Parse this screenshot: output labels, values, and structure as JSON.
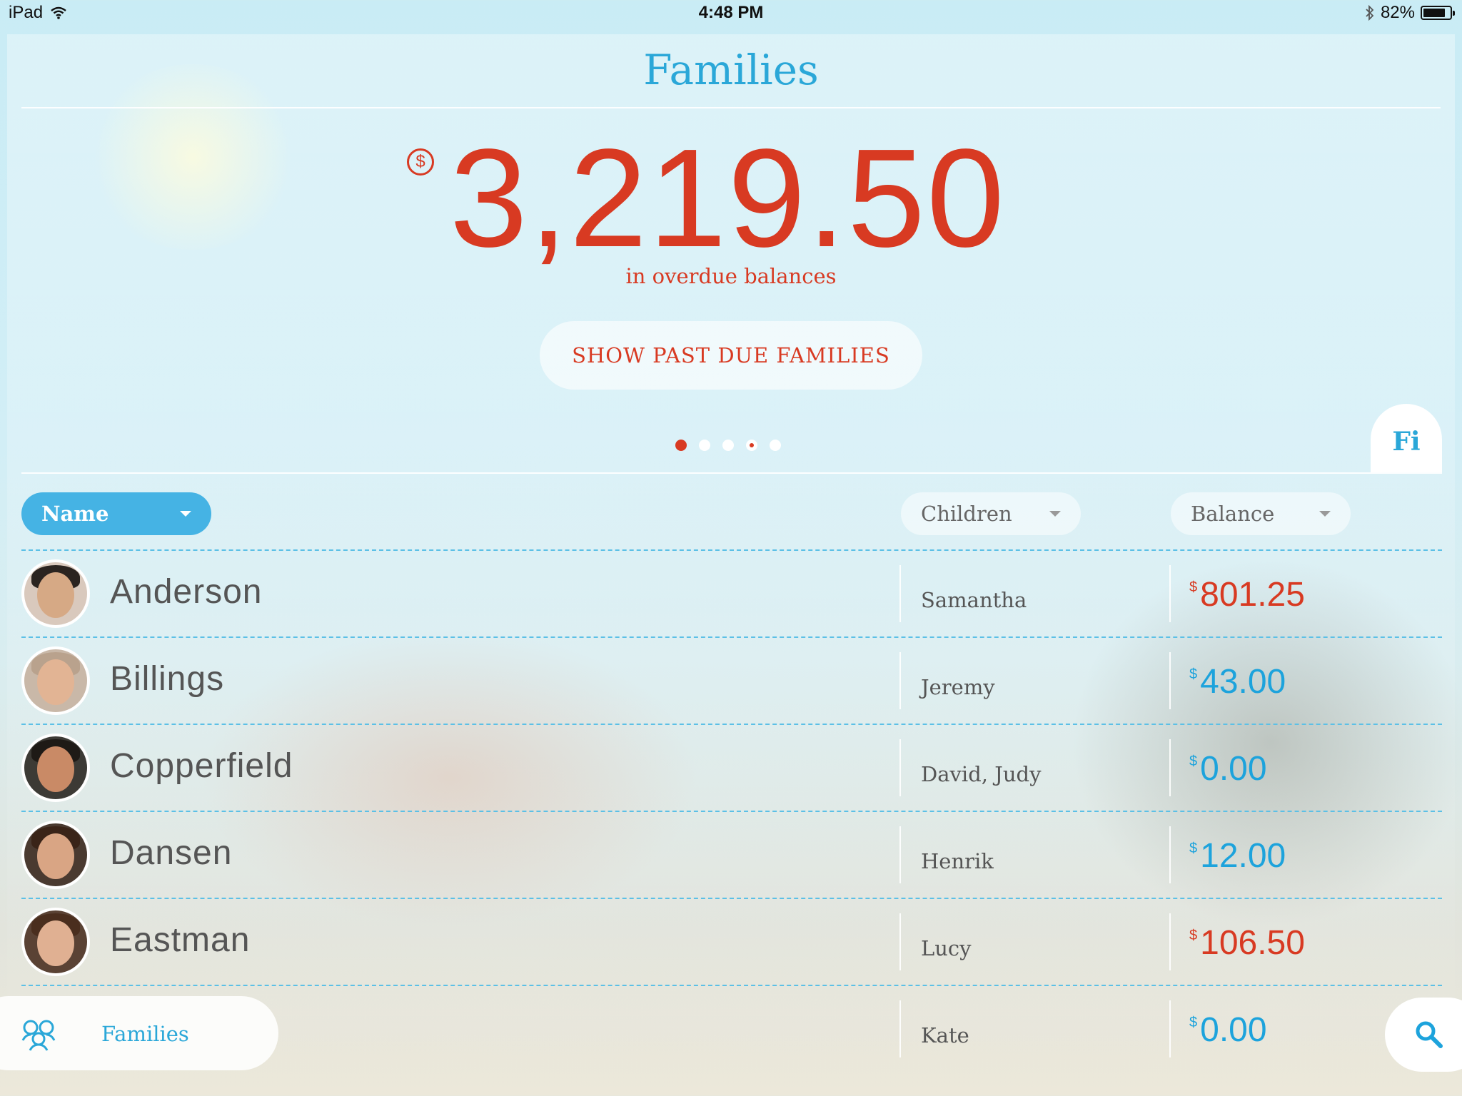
{
  "status_bar": {
    "device": "iPad",
    "time": "4:48 PM",
    "battery_percent": "82%",
    "battery_level": 0.82,
    "icons": [
      "wifi-icon",
      "bluetooth-icon",
      "battery-icon"
    ]
  },
  "header": {
    "title": "Families"
  },
  "summary": {
    "currency_symbol": "$",
    "total": "3,219.50",
    "caption": "in overdue balances",
    "button_label": "SHOW PAST DUE FAMILIES",
    "pager": {
      "count": 5,
      "active_index": 0,
      "marked_index": 3
    },
    "side_tab_label": "Fi"
  },
  "columns": {
    "name": "Name",
    "children": "Children",
    "balance": "Balance"
  },
  "families": [
    {
      "name": "Anderson",
      "children": "Samantha",
      "currency": "$",
      "balance": "801.25",
      "overdue": true
    },
    {
      "name": "Billings",
      "children": "Jeremy",
      "currency": "$",
      "balance": "43.00",
      "overdue": false
    },
    {
      "name": "Copperfield",
      "children": "David, Judy",
      "currency": "$",
      "balance": "0.00",
      "overdue": false
    },
    {
      "name": "Dansen",
      "children": "Henrik",
      "currency": "$",
      "balance": "12.00",
      "overdue": false
    },
    {
      "name": "Eastman",
      "children": "Lucy",
      "currency": "$",
      "balance": "106.50",
      "overdue": true
    },
    {
      "name": "",
      "children": "Kate",
      "currency": "$",
      "balance": "0.00",
      "overdue": false
    }
  ],
  "bottom_nav": {
    "label": "Families",
    "icon": "families-icon",
    "search_icon": "search-icon"
  },
  "colors": {
    "accent_blue": "#2aa7d8",
    "overdue_red": "#d83a22",
    "balance_blue": "#1da3dc"
  }
}
